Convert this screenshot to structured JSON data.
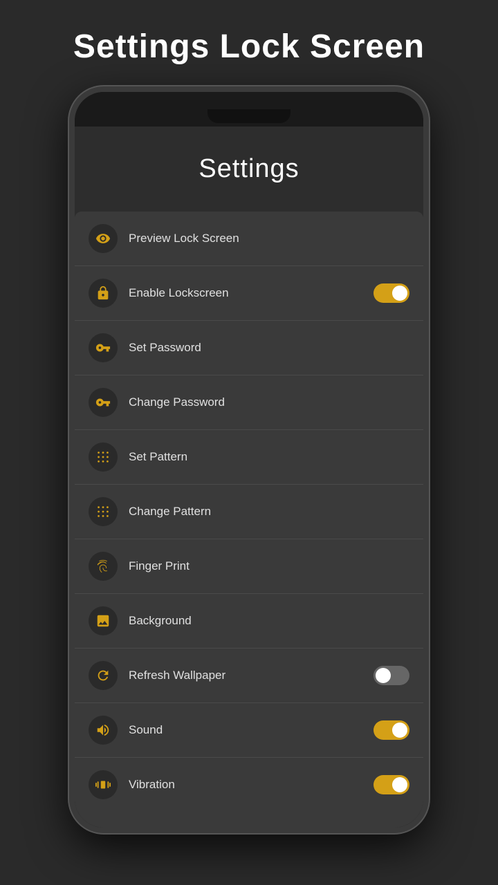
{
  "page": {
    "title": "Settings Lock Screen"
  },
  "screen": {
    "title": "Settings"
  },
  "settings_items": [
    {
      "id": "preview-lock-screen",
      "label": "Preview Lock Screen",
      "icon": "eye",
      "toggle": null,
      "icon_color": "gold"
    },
    {
      "id": "enable-lockscreen",
      "label": "Enable Lockscreen",
      "icon": "lock",
      "toggle": "on",
      "icon_color": "gold"
    },
    {
      "id": "set-password",
      "label": "Set Password",
      "icon": "key",
      "toggle": null,
      "icon_color": "gold"
    },
    {
      "id": "change-password",
      "label": "Change Password",
      "icon": "key",
      "toggle": null,
      "icon_color": "gold"
    },
    {
      "id": "set-pattern",
      "label": "Set Pattern",
      "icon": "pattern",
      "toggle": null,
      "icon_color": "gold"
    },
    {
      "id": "change-pattern",
      "label": "Change Pattern",
      "icon": "pattern",
      "toggle": null,
      "icon_color": "gold"
    },
    {
      "id": "finger-print",
      "label": "Finger Print",
      "icon": "fingerprint",
      "toggle": null,
      "icon_color": "gold"
    },
    {
      "id": "background",
      "label": "Background",
      "icon": "image",
      "toggle": null,
      "icon_color": "gold"
    },
    {
      "id": "refresh-wallpaper",
      "label": "Refresh Wallpaper",
      "icon": "refresh",
      "toggle": "off",
      "icon_color": "gold"
    },
    {
      "id": "sound",
      "label": "Sound",
      "icon": "sound",
      "toggle": "on",
      "icon_color": "gold"
    },
    {
      "id": "vibration",
      "label": "Vibration",
      "icon": "vibration",
      "toggle": "on",
      "icon_color": "gold"
    }
  ]
}
